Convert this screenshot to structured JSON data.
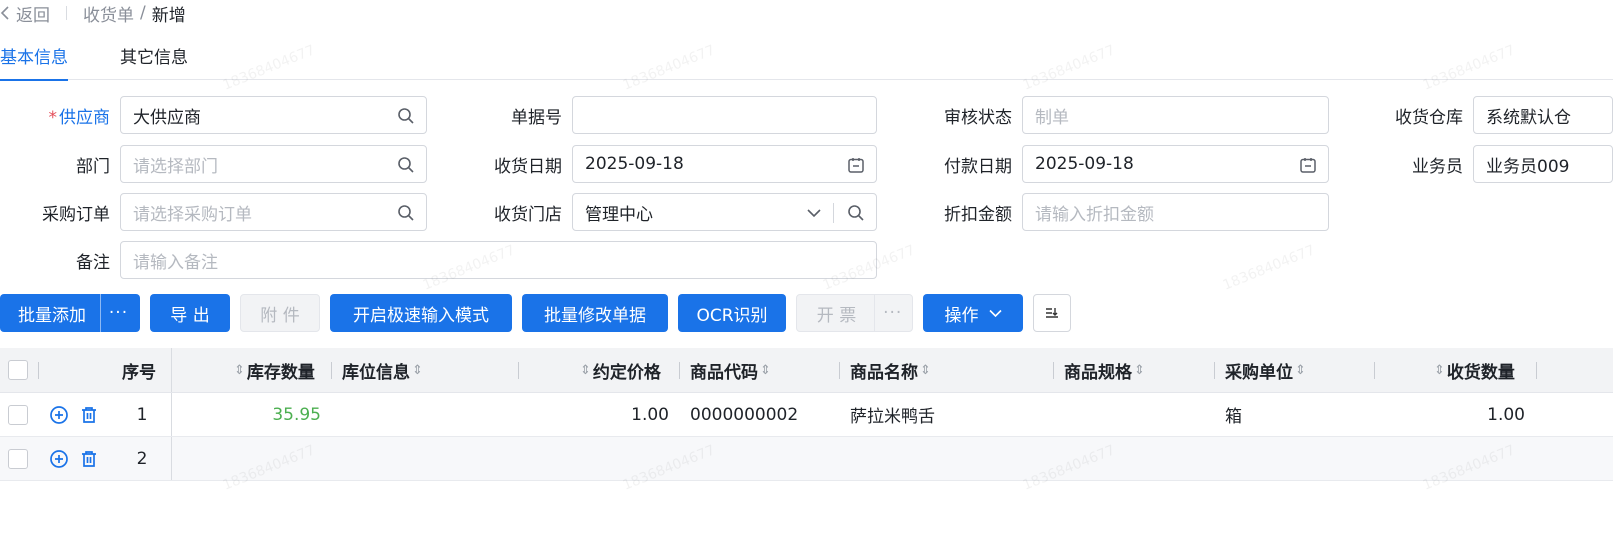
{
  "breadcrumb": {
    "back": "返回",
    "parent": "收货单",
    "current": "新增"
  },
  "tabs": [
    {
      "label": "基本信息"
    },
    {
      "label": "其它信息"
    }
  ],
  "form": {
    "supplier": {
      "label": "供应商",
      "value": "大供应商"
    },
    "doc_no": {
      "label": "单据号",
      "value": ""
    },
    "audit_status": {
      "label": "审核状态",
      "placeholder": "制单"
    },
    "warehouse": {
      "label": "收货仓库",
      "value": "系统默认仓"
    },
    "department": {
      "label": "部门",
      "placeholder": "请选择部门"
    },
    "receive_date": {
      "label": "收货日期",
      "value": "2025-09-18"
    },
    "pay_date": {
      "label": "付款日期",
      "value": "2025-09-18"
    },
    "salesman": {
      "label": "业务员",
      "value": "业务员009"
    },
    "purchase_order": {
      "label": "采购订单",
      "placeholder": "请选择采购订单"
    },
    "store": {
      "label": "收货门店",
      "value": "管理中心"
    },
    "discount": {
      "label": "折扣金额",
      "placeholder": "请输入折扣金额"
    },
    "remark": {
      "label": "备注",
      "placeholder": "请输入备注"
    }
  },
  "toolbar": {
    "batch_add": "批量添加",
    "more": "···",
    "export": "导 出",
    "attachment": "附 件",
    "fast_input": "开启极速输入模式",
    "batch_modify": "批量修改单据",
    "ocr": "OCR识别",
    "invoice": "开 票",
    "operate": "操作"
  },
  "table": {
    "headers": {
      "index": "序号",
      "stock_qty": "库存数量",
      "location": "库位信息",
      "price": "约定价格",
      "code": "商品代码",
      "name": "商品名称",
      "spec": "商品规格",
      "unit": "采购单位",
      "receive_qty": "收货数量"
    },
    "rows": [
      {
        "index": "1",
        "stock_qty": "35.95",
        "location": "",
        "price": "1.00",
        "code": "0000000002",
        "name": "萨拉米鸭舌",
        "spec": "",
        "unit": "箱",
        "receive_qty": "1.00"
      },
      {
        "index": "2",
        "stock_qty": "",
        "location": "",
        "price": "",
        "code": "",
        "name": "",
        "spec": "",
        "unit": "",
        "receive_qty": ""
      }
    ]
  },
  "watermark": "18368404677"
}
